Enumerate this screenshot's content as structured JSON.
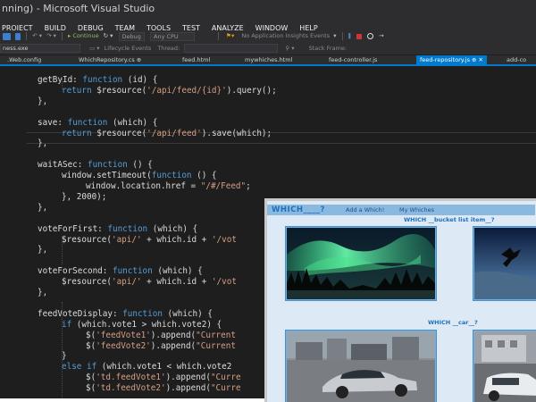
{
  "ide": {
    "title": "nning) - Microsoft Visual Studio",
    "menu": [
      "PROJECT",
      "BUILD",
      "DEBUG",
      "TEAM",
      "TOOLS",
      "TEST",
      "ANALYZE",
      "WINDOW",
      "HELP"
    ],
    "toolbar": {
      "continue_label": "▸ Continue",
      "debug_label": "Debug",
      "cpu_label": "Any CPU",
      "insights_label": "No Application Insights Events"
    },
    "toolbar2": {
      "process_label": "ness.exe",
      "lifecycle_label": "Lifecycle Events",
      "thread_label": "Thread:",
      "stackframe_label": "Stack Frame:"
    },
    "tabs": [
      {
        "label": ".Web.config",
        "active": false
      },
      {
        "label": "WhichRepository.cs ⊕",
        "active": false
      },
      {
        "label": "feed.html",
        "active": false
      },
      {
        "label": "mywhiches.html",
        "active": false
      },
      {
        "label": "feed-controller.js",
        "active": false
      },
      {
        "label": "feed-repository.js ⊕ ✕",
        "active": true
      },
      {
        "label": "add-co",
        "active": false
      }
    ],
    "code_lines": [
      {
        "indent": 0,
        "parts": [
          [
            "t",
            "getById: "
          ],
          [
            "k",
            "function"
          ],
          [
            "t",
            " (id) {"
          ]
        ]
      },
      {
        "indent": 1,
        "parts": [
          [
            "k",
            "return"
          ],
          [
            "t",
            " $resource("
          ],
          [
            "s",
            "'/api/feed/{id}'"
          ],
          [
            "t",
            ").query();"
          ]
        ]
      },
      {
        "indent": 0,
        "parts": [
          [
            "t",
            "},"
          ]
        ]
      },
      {
        "indent": 0,
        "parts": []
      },
      {
        "indent": 0,
        "parts": [
          [
            "t",
            "save: "
          ],
          [
            "k",
            "function"
          ],
          [
            "t",
            " (which) {"
          ]
        ]
      },
      {
        "indent": 1,
        "parts": [
          [
            "k",
            "return"
          ],
          [
            "t",
            " $resource("
          ],
          [
            "s",
            "'/api/feed'"
          ],
          [
            "t",
            ").save(which);"
          ]
        ]
      },
      {
        "indent": 0,
        "parts": [
          [
            "t",
            "},"
          ]
        ]
      },
      {
        "indent": 0,
        "parts": []
      },
      {
        "indent": 0,
        "parts": [
          [
            "t",
            "waitASec: "
          ],
          [
            "k",
            "function"
          ],
          [
            "t",
            " () {"
          ]
        ]
      },
      {
        "indent": 1,
        "parts": [
          [
            "t",
            "window.setTimeout("
          ],
          [
            "k",
            "function"
          ],
          [
            "t",
            " () {"
          ]
        ]
      },
      {
        "indent": 2,
        "parts": [
          [
            "t",
            "window.location.href = "
          ],
          [
            "s",
            "\"/#/Feed\""
          ],
          [
            "t",
            ";"
          ]
        ]
      },
      {
        "indent": 1,
        "parts": [
          [
            "t",
            "}, 2000);"
          ]
        ]
      },
      {
        "indent": 0,
        "parts": [
          [
            "t",
            "},"
          ]
        ]
      },
      {
        "indent": 0,
        "parts": []
      },
      {
        "indent": 0,
        "parts": [
          [
            "t",
            "voteForFirst: "
          ],
          [
            "k",
            "function"
          ],
          [
            "t",
            " (which) {"
          ]
        ]
      },
      {
        "indent": 1,
        "parts": [
          [
            "t",
            "$resource("
          ],
          [
            "s",
            "'api/'"
          ],
          [
            "t",
            " + which.id + "
          ],
          [
            "s",
            "'/vot"
          ]
        ]
      },
      {
        "indent": 0,
        "parts": [
          [
            "t",
            "},"
          ]
        ]
      },
      {
        "indent": 0,
        "parts": []
      },
      {
        "indent": 0,
        "parts": [
          [
            "t",
            "voteForSecond: "
          ],
          [
            "k",
            "function"
          ],
          [
            "t",
            " (which) {"
          ]
        ]
      },
      {
        "indent": 1,
        "parts": [
          [
            "t",
            "$resource("
          ],
          [
            "s",
            "'api/'"
          ],
          [
            "t",
            " + which.id + "
          ],
          [
            "s",
            "'/vot"
          ]
        ]
      },
      {
        "indent": 0,
        "parts": [
          [
            "t",
            "},"
          ]
        ]
      },
      {
        "indent": 0,
        "parts": []
      },
      {
        "indent": 0,
        "parts": [
          [
            "t",
            "feedVoteDisplay: "
          ],
          [
            "k",
            "function"
          ],
          [
            "t",
            " (which) {"
          ]
        ]
      },
      {
        "indent": 1,
        "parts": [
          [
            "k",
            "if"
          ],
          [
            "t",
            " (which.vote1 > which.vote2) {"
          ]
        ]
      },
      {
        "indent": 2,
        "parts": [
          [
            "t",
            "$("
          ],
          [
            "s",
            "'feedVote1'"
          ],
          [
            "t",
            ").append("
          ],
          [
            "s",
            "\"Current"
          ]
        ]
      },
      {
        "indent": 2,
        "parts": [
          [
            "t",
            "$("
          ],
          [
            "s",
            "'feedVote2'"
          ],
          [
            "t",
            ").append("
          ],
          [
            "s",
            "\"Current"
          ]
        ]
      },
      {
        "indent": 1,
        "parts": [
          [
            "t",
            "}"
          ]
        ]
      },
      {
        "indent": 1,
        "parts": [
          [
            "k",
            "else if"
          ],
          [
            "t",
            " (which.vote1 < which.vote2"
          ]
        ]
      },
      {
        "indent": 2,
        "parts": [
          [
            "t",
            "$("
          ],
          [
            "s",
            "'td.feedVote1'"
          ],
          [
            "t",
            ").append("
          ],
          [
            "s",
            "\"Curre"
          ]
        ]
      },
      {
        "indent": 2,
        "parts": [
          [
            "t",
            "$("
          ],
          [
            "s",
            "'td.feedVote2'"
          ],
          [
            "t",
            ").append("
          ],
          [
            "s",
            "\"Curre"
          ]
        ]
      }
    ]
  },
  "site": {
    "logo": "WHICH____?",
    "nav": [
      "Add a Which!",
      "My Whiches"
    ],
    "section1_title": "WHICH __bucket list item__?",
    "section2_title": "WHICH __car__?"
  },
  "colors": {
    "ide_bg": "#1e1e1e",
    "ide_chrome": "#2d2d30",
    "accent": "#007acc",
    "keyword": "#569cd6",
    "string": "#d69d85",
    "site_bg": "#dde9f5",
    "site_header": "#89b9df"
  }
}
